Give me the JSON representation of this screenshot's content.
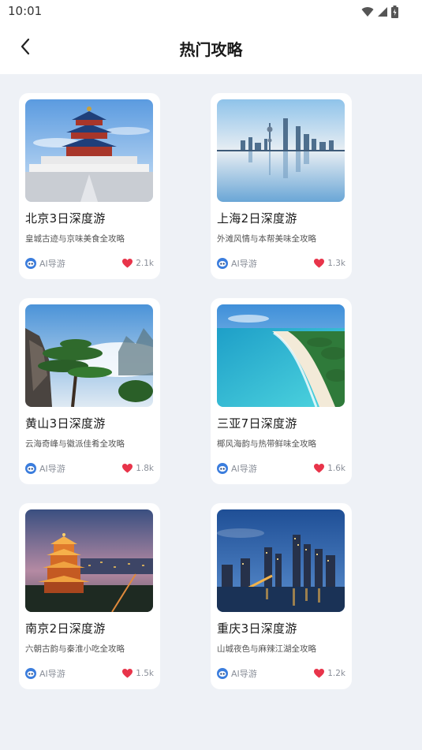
{
  "status": {
    "time": "10:01"
  },
  "header": {
    "title": "热门攻略"
  },
  "cards": [
    {
      "title": "北京3日深度游",
      "subtitle": "皇城古迹与京味美食全攻略",
      "author": "AI导游",
      "likes": "2.1k",
      "image": "temple-of-heaven"
    },
    {
      "title": "上海2日深度游",
      "subtitle": "外滩风情与本帮美味全攻略",
      "author": "AI导游",
      "likes": "1.3k",
      "image": "shanghai-skyline"
    },
    {
      "title": "黄山3日深度游",
      "subtitle": "云海奇峰与徽派佳肴全攻略",
      "author": "AI导游",
      "likes": "1.8k",
      "image": "huangshan-pine"
    },
    {
      "title": "三亚7日深度游",
      "subtitle": "椰风海韵与热带鲜味全攻略",
      "author": "AI导游",
      "likes": "1.6k",
      "image": "sanya-beach"
    },
    {
      "title": "南京2日深度游",
      "subtitle": "六朝古韵与秦淮小吃全攻略",
      "author": "AI导游",
      "likes": "1.5k",
      "image": "nanjing-tower"
    },
    {
      "title": "重庆3日深度游",
      "subtitle": "山城夜色与麻辣江湖全攻略",
      "author": "AI导游",
      "likes": "1.2k",
      "image": "chongqing-night"
    }
  ],
  "colors": {
    "like": "#e8344a",
    "avatar": "#3b7ddd",
    "background": "#eef1f6"
  },
  "icons": {
    "back": "chevron-left-icon",
    "like": "heart-icon",
    "author": "robot-avatar-icon",
    "wifi": "wifi-icon",
    "signal": "signal-icon",
    "battery": "battery-icon"
  }
}
